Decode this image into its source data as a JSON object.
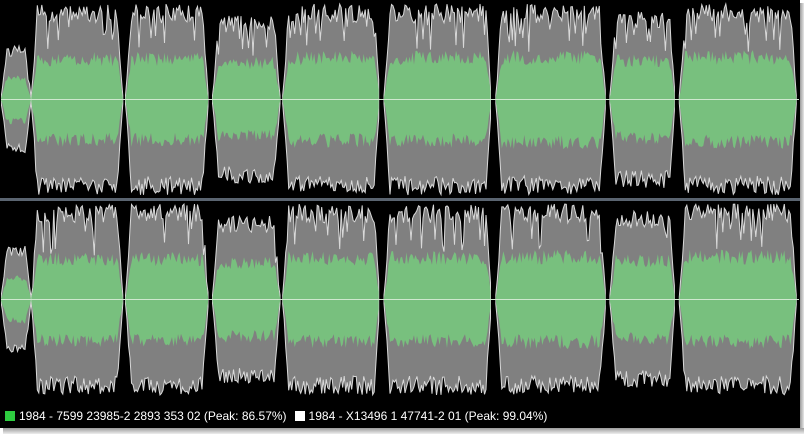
{
  "colors": {
    "background": "#000000",
    "peak_wave": "#808080",
    "peak_outline": "#d8d8d8",
    "rms_wave": "#78c07e",
    "center_line": "#cfe8cf",
    "separator": "#5a6470"
  },
  "waveform": {
    "channels": [
      "left",
      "right"
    ],
    "segments": [
      {
        "start": 0.0,
        "end": 0.038,
        "peak": 0.55,
        "rms": 0.22
      },
      {
        "start": 0.038,
        "end": 0.153,
        "peak": 0.97,
        "rms": 0.42
      },
      {
        "start": 0.156,
        "end": 0.26,
        "peak": 0.97,
        "rms": 0.42
      },
      {
        "start": 0.265,
        "end": 0.35,
        "peak": 0.85,
        "rms": 0.38
      },
      {
        "start": 0.353,
        "end": 0.475,
        "peak": 0.97,
        "rms": 0.43
      },
      {
        "start": 0.48,
        "end": 0.615,
        "peak": 0.97,
        "rms": 0.43
      },
      {
        "start": 0.62,
        "end": 0.758,
        "peak": 0.97,
        "rms": 0.44
      },
      {
        "start": 0.763,
        "end": 0.845,
        "peak": 0.9,
        "rms": 0.4
      },
      {
        "start": 0.85,
        "end": 0.997,
        "peak": 0.97,
        "rms": 0.44
      }
    ]
  },
  "legend": {
    "items": [
      {
        "label": "1984 - 7599 23985-2 2893 353 02 (Peak: 86.57%)",
        "color": "#2ecc40",
        "icon": "square-swatch-icon"
      },
      {
        "label": "1984 - X13496 1 47741-2 01 (Peak: 99.04%)",
        "color": "#ffffff",
        "icon": "square-swatch-icon"
      }
    ]
  }
}
